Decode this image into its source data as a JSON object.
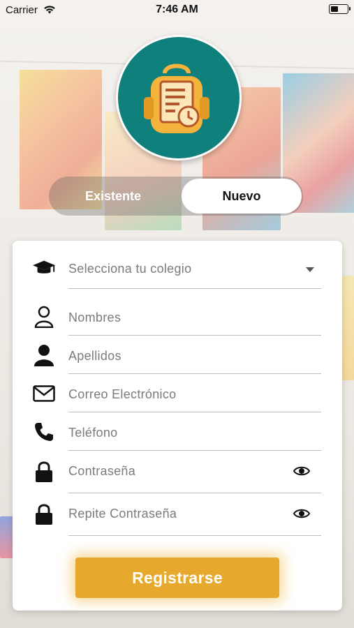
{
  "status_bar": {
    "carrier": "Carrier",
    "time": "7:46 AM",
    "battery_level": 0.45
  },
  "logo": {
    "icon": "backpack-clock-icon",
    "colors": {
      "circle": "#10807c",
      "bag": "#f3b33d",
      "note": "#fbe7b8",
      "accent": "#b5562a"
    }
  },
  "segmented": {
    "existing_label": "Existente",
    "new_label": "Nuevo",
    "selected": "Nuevo"
  },
  "form": {
    "school": {
      "placeholder": "Selecciona tu colegio",
      "icon": "graduation-cap-icon"
    },
    "first_names": {
      "placeholder": "Nombres",
      "icon": "user-outline-icon"
    },
    "last_names": {
      "placeholder": "Apellidos",
      "icon": "user-filled-icon"
    },
    "email": {
      "placeholder": "Correo Electrónico",
      "icon": "envelope-icon"
    },
    "phone": {
      "placeholder": "Teléfono",
      "icon": "phone-icon"
    },
    "password": {
      "placeholder": "Contraseña",
      "icon": "lock-icon",
      "toggle_icon": "eye-icon"
    },
    "password_repeat": {
      "placeholder": "Repite Contraseña",
      "icon": "lock-icon",
      "toggle_icon": "eye-icon"
    }
  },
  "submit": {
    "label": "Registrarse",
    "color": "#e6a92e"
  }
}
